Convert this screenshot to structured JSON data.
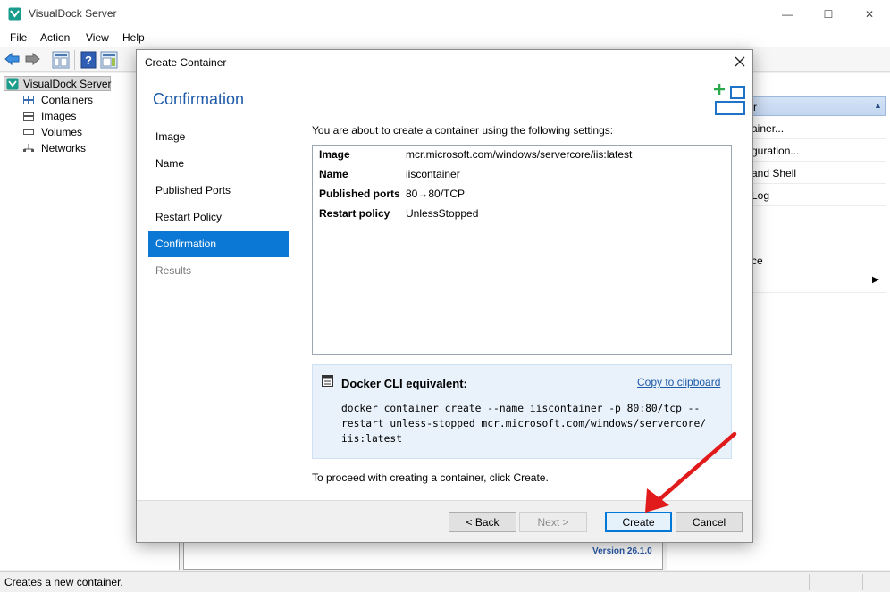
{
  "window": {
    "title": "VisualDock Server",
    "minimize": "—",
    "maximize": "☐",
    "close": "✕"
  },
  "menu": [
    "File",
    "Action",
    "View",
    "Help"
  ],
  "tree": {
    "root": "VisualDock Server",
    "children": [
      "Containers",
      "Images",
      "Volumes",
      "Networks"
    ]
  },
  "actions_pane": {
    "rows": [
      "ainer...",
      "guration...",
      "and Shell",
      "Log",
      "ce"
    ]
  },
  "center": {
    "version": "Version 26.1.0"
  },
  "status": {
    "text": "Creates a new container."
  },
  "dialog": {
    "title": "Create Container",
    "close": "✕",
    "heading": "Confirmation",
    "nav": [
      "Image",
      "Name",
      "Published Ports",
      "Restart Policy",
      "Confirmation",
      "Results"
    ],
    "intro": "You are about to create a container using the following settings:",
    "settings": [
      {
        "key": "Image",
        "value": "mcr.microsoft.com/windows/servercore/iis:latest"
      },
      {
        "key": "Name",
        "value": "iiscontainer"
      },
      {
        "key": "Published ports",
        "value": "80→80/TCP"
      },
      {
        "key": "Restart policy",
        "value": "UnlessStopped"
      }
    ],
    "cli": {
      "title": "Docker CLI equivalent:",
      "copy": "Copy to clipboard",
      "code": "docker container create --name iiscontainer -p 80:80/tcp --\nrestart unless-stopped mcr.microsoft.com/windows/servercore/\niis:latest"
    },
    "proceed": "To proceed with creating a container, click Create.",
    "buttons": {
      "back": "< Back",
      "next": "Next >",
      "create": "Create",
      "cancel": "Cancel"
    }
  },
  "colors": {
    "accent": "#0a78d4",
    "heading": "#1e5aa8",
    "arrow": "#e11b1b"
  }
}
